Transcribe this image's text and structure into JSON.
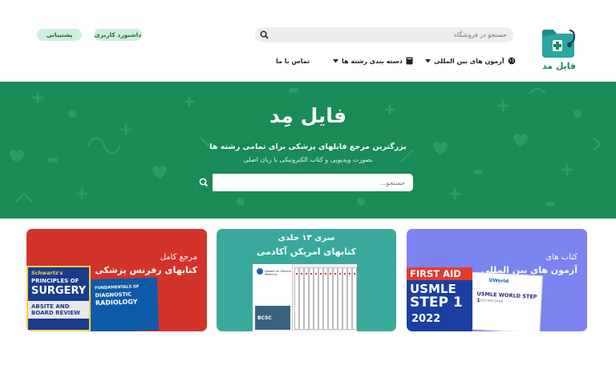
{
  "brand": {
    "logo_text": "فایل مد",
    "accent": "#1a8a56"
  },
  "header": {
    "search_placeholder": "جستجو در فروشگاه",
    "support_label": "پشتیبانی",
    "dashboard_label": "داشبورد کاربری",
    "nav": [
      {
        "label": "آزمون های بین المللی",
        "icon": "globe-icon",
        "has_dropdown": true
      },
      {
        "label": "دسته بندی رشته ها",
        "icon": "book-icon",
        "has_dropdown": true
      },
      {
        "label": "تماس با ما",
        "has_dropdown": false
      }
    ]
  },
  "hero": {
    "title": "فایل مِد",
    "subtitle": "بزرگترین مرجع فایلهای پزشکی برای تمامی رشته ها",
    "subtitle2": "بصورت ویدیویی و کتاب الکترونیکی با زبان اصلی",
    "search_placeholder": "جستجو..."
  },
  "cards": [
    {
      "line1": "مرجع کامل",
      "line2": "کتابهای رفرنس پزشکی",
      "color": "#d4332b",
      "books": {
        "b1_author": "Schwartz's",
        "b1_title1": "PRINCIPLES OF",
        "b1_title2": "SURGERY",
        "b1_band": "ABSITE AND BOARD REVIEW",
        "b2_top": "FUNDAMENTALS OF",
        "b2_title1": "DIAGNOSTIC",
        "b2_title2": "RADIOLOGY"
      }
    },
    {
      "line1": "سری ۱۳ جلدی",
      "line2": "کتابهای امریکن آکادمی",
      "color": "#3aa99c",
      "books": {
        "front_head": "Update on General Medicine",
        "front_label": "BCSC"
      }
    },
    {
      "line1": "کتاب های",
      "line2": "آزمون های بین المللی",
      "color": "#7a83f0",
      "books": {
        "fa_top": "FIRST AID",
        "fa_title1": "USMLE",
        "fa_title2": "STEP 1",
        "fa_year": "2022",
        "uw_brand": "UWorld",
        "uw_title": "USMLE WORLD STEP 1",
        "uw_sub": "QUESTION BANK"
      }
    }
  ]
}
